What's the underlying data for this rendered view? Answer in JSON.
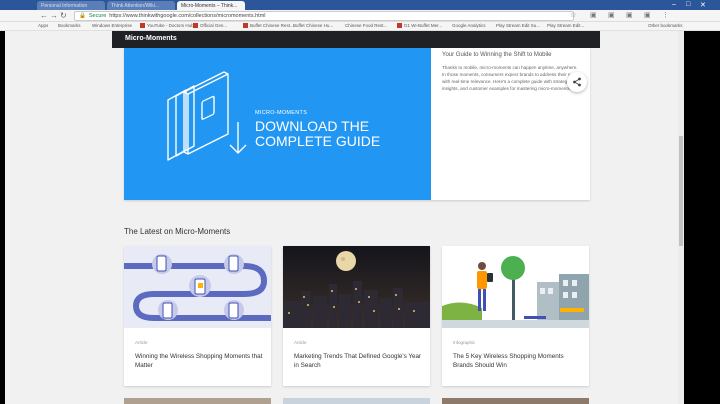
{
  "browser": {
    "tabs": [
      {
        "label": "Personal Information"
      },
      {
        "label": "Think Attention/Wiki..."
      },
      {
        "label": "Micro-Moments – Think..."
      }
    ],
    "url": "https://www.thinkwithgoogle.com/collections/micromoments.html",
    "secure_label": "Secure",
    "bookmarks": [
      {
        "label": "Apps"
      },
      {
        "label": "Bookmarks"
      },
      {
        "label": "Windows Enterprise"
      },
      {
        "label": "YouTube - Doctors Hub"
      },
      {
        "label": "Official Gen..."
      },
      {
        "label": "Buffet Chinese Rest..."
      },
      {
        "label": "Buffet Chinese Hu..."
      },
      {
        "label": "Chinese Food Rest..."
      },
      {
        "label": "G1 Wi-Buffet Mer..."
      },
      {
        "label": "Google Analytics"
      },
      {
        "label": "Play Stream Edit Su..."
      },
      {
        "label": "Play Stream Edit..."
      },
      {
        "label": "Other bookmarks"
      }
    ]
  },
  "site": {
    "header_title": "Micro-Moments"
  },
  "hero": {
    "kicker": "MICRO-MOMENTS",
    "title_line1": "DOWNLOAD THE",
    "title_line2": "COMPLETE GUIDE",
    "subtitle": "Your Guide to Winning the Shift to Mobile",
    "body": "Thanks to mobile, micro-moments can happen anytime, anywhere. In those moments, consumers expect brands to address their needs with real-time relevance. Here's a complete guide with strategies, insights, and customer examples for mastering micro-moments."
  },
  "latest": {
    "title": "The Latest on Micro-Moments",
    "cards": [
      {
        "kicker": "Article",
        "title": "Winning the Wireless Shopping Moments that Matter"
      },
      {
        "kicker": "Article",
        "title": "Marketing Trends That Defined Google's Year in Search"
      },
      {
        "kicker": "Infographic",
        "title": "The 5 Key Wireless Shopping Moments Brands Should Win"
      }
    ]
  },
  "colors": {
    "hero_blue": "#2196f3",
    "header_dark": "#202124",
    "chrome_blue": "#2b579a"
  }
}
